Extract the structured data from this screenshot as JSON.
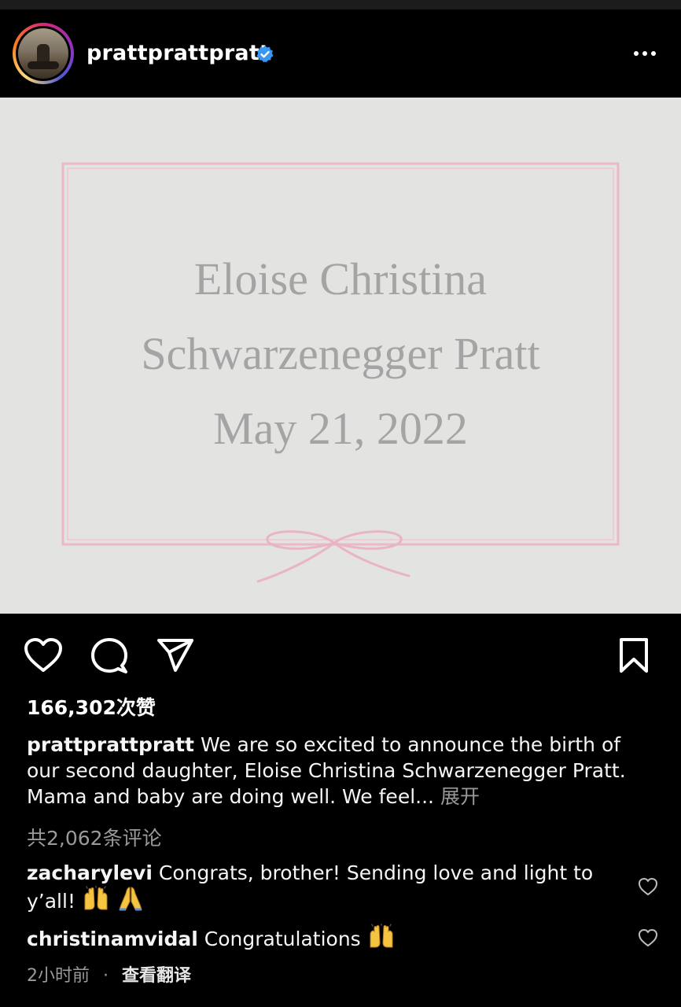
{
  "header": {
    "username": "prattprattpratt",
    "verified_icon": "verified-badge-icon",
    "more_icon": "more-dots-icon",
    "colors": {
      "verified": "#3897f0",
      "ring_start": "#d62976",
      "ring_end": "#feda75"
    }
  },
  "post": {
    "image": {
      "line1": "Eloise Christina",
      "line2": "Schwarzenegger Pratt",
      "line3": "May 21, 2022",
      "colors": {
        "background": "#e3e3e1",
        "border": "#e9b9c7",
        "text": "#a4a4a4"
      }
    },
    "actions": {
      "like_icon": "heart-icon",
      "comment_icon": "comment-bubble-icon",
      "share_icon": "send-icon",
      "save_icon": "bookmark-icon"
    },
    "likes": "166,302次赞",
    "caption": {
      "username": "prattprattpratt",
      "text": "We are so excited to announce the birth of our second daughter, Eloise Christina Schwarzenegger Pratt. Mama and baby are doing well. We feel...",
      "more_label": "展开"
    },
    "comments_count_label": "共2,062条评论",
    "comments": [
      {
        "username": "zacharylevi",
        "text": "Congrats, brother! Sending love and light to y’all!",
        "emojis": [
          "raising-hands-icon",
          "folded-hands-icon"
        ]
      },
      {
        "username": "christinamvidal",
        "text": "Congratulations",
        "emojis": [
          "raising-hands-icon"
        ]
      }
    ],
    "time_ago": "2小时前",
    "separator": "·",
    "translate_label": "查看翻译"
  }
}
